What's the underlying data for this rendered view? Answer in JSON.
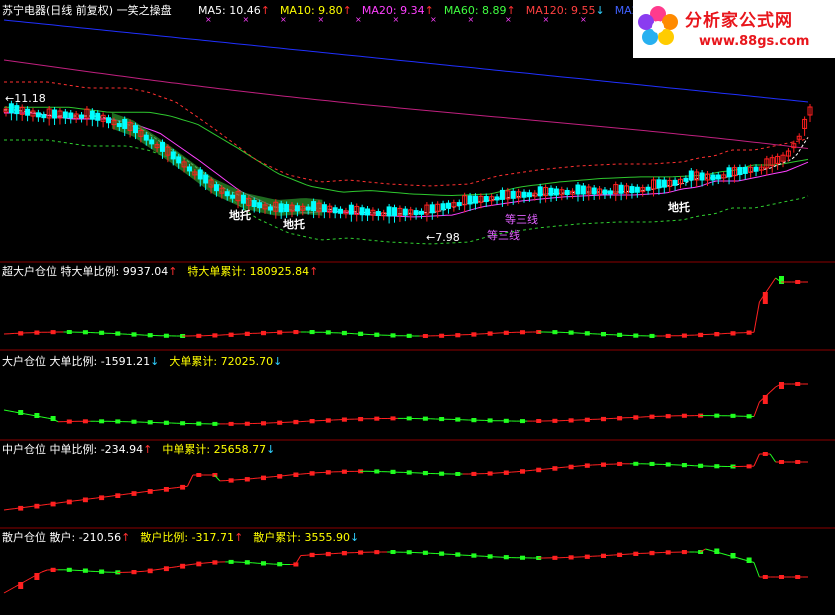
{
  "title": "苏宁电器(日线 前复权) 一笑之操盘",
  "ma_legend": [
    {
      "label": "MA5: 10.46",
      "arrow": "↑",
      "color": "#ffffff",
      "arrow_color": "#ff3030"
    },
    {
      "label": "MA10: 9.80",
      "arrow": "↑",
      "color": "#ffff00",
      "arrow_color": "#ff3030"
    },
    {
      "label": "MA20: 9.34",
      "arrow": "↑",
      "color": "#ff40ff",
      "arrow_color": "#ff3030"
    },
    {
      "label": "MA60: 8.89",
      "arrow": "↑",
      "color": "#40ff40",
      "arrow_color": "#ff3030"
    },
    {
      "label": "MA120: 9.55",
      "arrow": "↓",
      "color": "#ff4040",
      "arrow_color": "#30d0ff"
    },
    {
      "label": "MA240: 1",
      "arrow": "",
      "color": "#4060ff",
      "arrow_color": "#4060ff"
    }
  ],
  "price_annotations": {
    "high": "11.18",
    "low": "7.98",
    "support_labels": [
      "地托",
      "地托",
      "地托"
    ],
    "line_labels": [
      "等三线",
      "等三线"
    ]
  },
  "panels": [
    {
      "name": "超大户仓位",
      "items": [
        {
          "text": "特大单比例: 9937.04",
          "arrow": "↑",
          "color": "#ffffff",
          "arrow_color": "#ff3030"
        },
        {
          "text": "特大单累计: 180925.84",
          "arrow": "↑",
          "color": "#ffff00",
          "arrow_color": "#ff3030"
        }
      ]
    },
    {
      "name": "大户仓位",
      "items": [
        {
          "text": "大单比例: -1591.21",
          "arrow": "↓",
          "color": "#ffffff",
          "arrow_color": "#30d0ff"
        },
        {
          "text": "大单累计: 72025.70",
          "arrow": "↓",
          "color": "#ffff00",
          "arrow_color": "#30d0ff"
        }
      ]
    },
    {
      "name": "中户仓位",
      "items": [
        {
          "text": "中单比例: -234.94",
          "arrow": "↑",
          "color": "#ffffff",
          "arrow_color": "#ff3030"
        },
        {
          "text": "中单累计: 25658.77",
          "arrow": "↓",
          "color": "#ffff00",
          "arrow_color": "#30d0ff"
        }
      ]
    },
    {
      "name": "散户仓位",
      "items": [
        {
          "text": "散户: -210.56",
          "arrow": "↑",
          "color": "#ffffff",
          "arrow_color": "#ff3030"
        },
        {
          "text": "散户比例: -317.71",
          "arrow": "↑",
          "color": "#ffff00",
          "arrow_color": "#ff3030"
        },
        {
          "text": "散户累计: 3555.90",
          "arrow": "↓",
          "color": "#ffff00",
          "arrow_color": "#30d0ff"
        }
      ]
    }
  ],
  "watermark": {
    "title": "分析家公式网",
    "url": "www.88gs.com"
  },
  "colors": {
    "up": "#ff2020",
    "down": "#00ffff",
    "accent_green": "#30ff30",
    "panel_border": "#8b0000",
    "background": "#000000"
  }
}
